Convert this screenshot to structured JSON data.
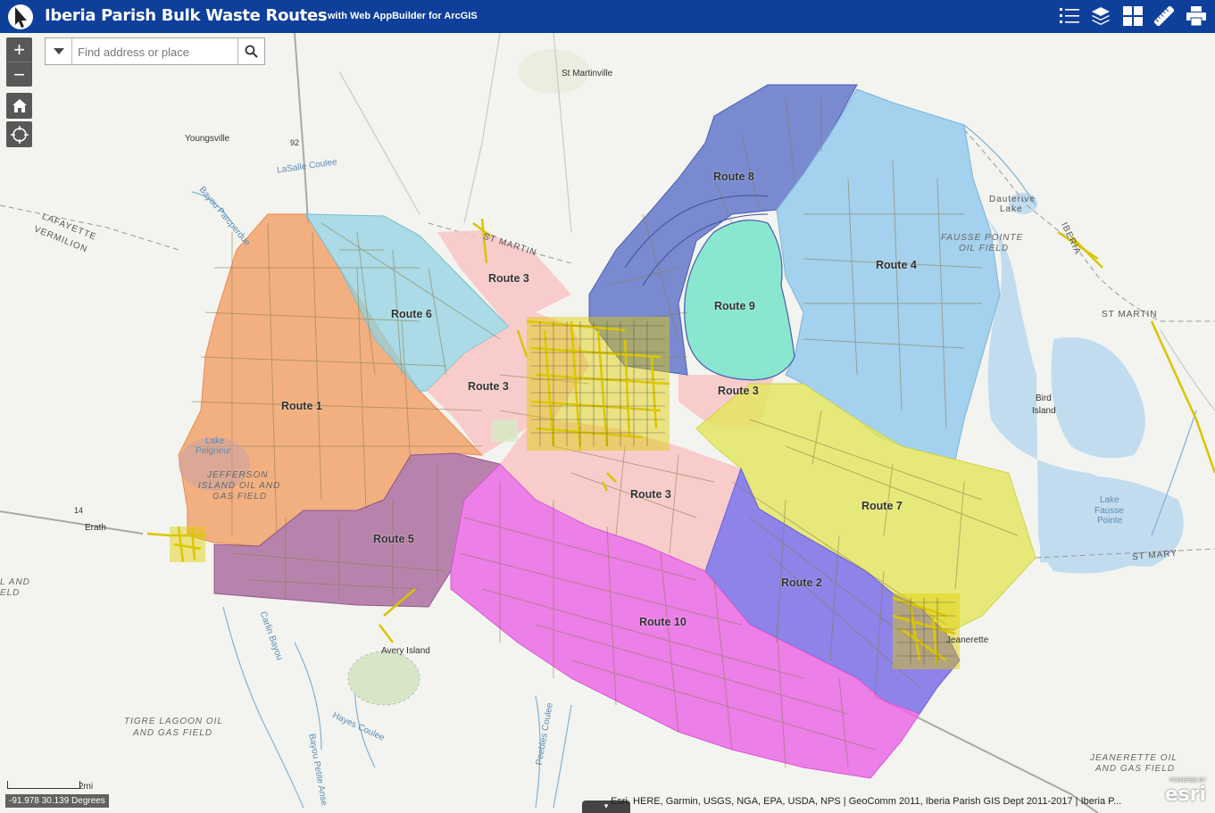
{
  "app": {
    "title": "Iberia Parish Bulk Waste Routes",
    "subtitle": "with Web AppBuilder for ArcGIS"
  },
  "toolbar": {
    "icons": [
      "legend-icon",
      "layer-list-icon",
      "basemap-gallery-icon",
      "measurement-icon",
      "print-icon"
    ]
  },
  "search": {
    "placeholder": "Find address or place",
    "value": ""
  },
  "zoom": {
    "in_label": "+",
    "out_label": "−"
  },
  "routes": [
    {
      "label": "Route 1",
      "color": "#f2995c"
    },
    {
      "label": "Route 2",
      "color": "#7a6fe8"
    },
    {
      "label": "Route 3",
      "color": "#f8c4c4"
    },
    {
      "label": "Route 4",
      "color": "#90c8ec"
    },
    {
      "label": "Route 5",
      "color": "#a8679b"
    },
    {
      "label": "Route 6",
      "color": "#92d3e3"
    },
    {
      "label": "Route 7",
      "color": "#e2e65b"
    },
    {
      "label": "Route 8",
      "color": "#5a6fc8"
    },
    {
      "label": "Route 9",
      "color": "#7de6cc"
    },
    {
      "label": "Route 10",
      "color": "#ea6ae6"
    }
  ],
  "route_label_instances": [
    "Route 8",
    "Route 4",
    "Route 3",
    "Route 6",
    "Route 9",
    "Route 3",
    "Route 3",
    "Route 1",
    "Route 3",
    "Route 7",
    "Route 5",
    "Route 2",
    "Route 10"
  ],
  "places": {
    "st_martinville": "St Martinville",
    "youngsville": "Youngsville",
    "lasalle_coulee": "LaSalle Coulee",
    "bayou_parc": "Bayou Parcperdue",
    "lafayette": "LAFAYETTE",
    "vermilion": "VERMILION",
    "st_martin_top": "ST MARTIN",
    "iberia_top": "IBERIA",
    "dauterive": "Dauterive",
    "dauterive2": "Lake",
    "fausse_pointe": "FAUSSE POINTE",
    "oil_field": "OIL FIELD",
    "iberia_right": "IBERIA",
    "st_martin_right": "ST MARTIN",
    "bird": "Bird",
    "island": "Island",
    "lake": "Lake",
    "fausse": "Fausse",
    "pointe": "Pointe",
    "st_mary": "ST MARY",
    "lake_peigneur": "Lake",
    "lake_peigneur2": "Peigneur",
    "jefferson": "JEFFERSON",
    "island_oil": "ISLAND OIL AND",
    "gas_field": "GAS FIELD",
    "erath": "Erath",
    "and_left": "L AND",
    "eld_left": "ELD",
    "avery": "Avery Island",
    "tigre": "TIGRE LAGOON OIL",
    "tigre2": "AND GAS FIELD",
    "jeanerette": "Jeanerette",
    "jeanerette_oil": "JEANERETTE OIL",
    "jeanerette_gas": "AND GAS FIELD",
    "hayes": "Hayes Coulee",
    "peebles": "Peebles Coulee",
    "carlin": "Carlin Bayou",
    "bayou_petite": "Bayou Petite Anse",
    "hwy92": "92",
    "hwy14": "14"
  },
  "scale": {
    "label": "2mi"
  },
  "coordinates": "-91.978 30.139 Degrees",
  "attribution": "Esri, HERE, Garmin, USGS, NGA, EPA, USDA, NPS | GeoComm 2011, Iberia Parish GIS Dept 2011-2017 | Iberia P...",
  "esri_logo": {
    "powered_by": "POWERED BY",
    "brand": "esri"
  }
}
